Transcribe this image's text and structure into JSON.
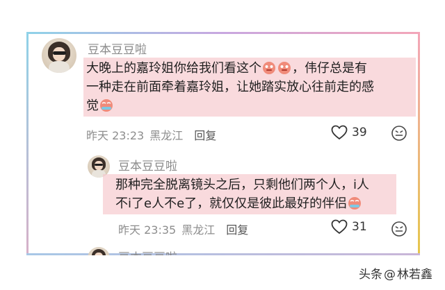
{
  "comments": [
    {
      "username": "豆本豆豆啦",
      "text_line1": "大晚上的嘉玲姐你给我们看这个",
      "text_line1_tail": "，伟仔总是有",
      "text_line2": "一种走在前面牵着嘉玲姐，让她踏实放心往前走的感",
      "text_line3": "觉",
      "time": "昨天 23:23",
      "location": "黑龙江",
      "reply_label": "回复",
      "likes": "39"
    },
    {
      "username": "豆本豆豆啦",
      "text_line1": "那种完全脱离镜头之后，只剩他们两个人，i人",
      "text_line2": "不i了e人不e了，就仅仅是彼此最好的伴侣",
      "time": "昨天 23:35",
      "location": "黑龙江",
      "reply_label": "回复",
      "likes": "31"
    },
    {
      "username": "豆本豆豆啦"
    }
  ],
  "watermark": {
    "prefix": "头条",
    "at": "@",
    "author": "林若鑫"
  },
  "colors": {
    "highlight": "#f6c4c8",
    "username": "#8a8a8a",
    "meta": "#8d8d8d"
  }
}
